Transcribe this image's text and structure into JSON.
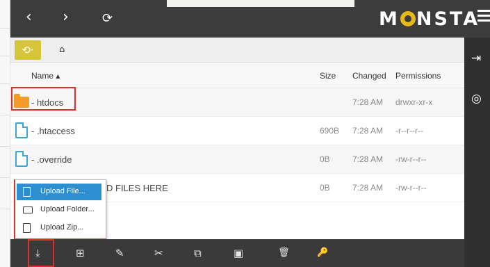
{
  "topbar": {
    "back_icon": "‹",
    "forward_icon": "›",
    "refresh_icon": "⟳",
    "logo_left": "M",
    "logo_right": "NSTA",
    "brand_color": "#e8b81d"
  },
  "breadcrumb": {
    "history_label": "⟲·",
    "home_icon": "⌂"
  },
  "table": {
    "headers": {
      "name": "Name ▴",
      "size": "Size",
      "changed": "Changed",
      "permissions": "Permissions"
    },
    "rows": [
      {
        "name": "- htdocs",
        "size": "",
        "changed": "7:28 AM",
        "permissions": "drwxr-xr-x",
        "type": "folder"
      },
      {
        "name": "- .htaccess",
        "size": "690B",
        "changed": "7:28 AM",
        "permissions": "-r--r--r--",
        "type": "file"
      },
      {
        "name": "- .override",
        "size": "0B",
        "changed": "7:28 AM",
        "permissions": "-rw-r--r--",
        "type": "file"
      },
      {
        "name": "D FILES HERE",
        "size": "0B",
        "changed": "7:28 AM",
        "permissions": "-rw-r--r--",
        "type": "file"
      }
    ]
  },
  "upload_menu": {
    "items": [
      {
        "label": "Upload File...",
        "icon": "file-icon"
      },
      {
        "label": "Upload Folder...",
        "icon": "folder-icon"
      },
      {
        "label": "Upload Zip...",
        "icon": "zip-icon"
      }
    ],
    "active_color": "#2d8fd0"
  },
  "toolbar": {
    "upload": "⤓",
    "new": "⊞",
    "edit": "✎",
    "cut": "✂",
    "copy": "⧉",
    "paste": "▣",
    "delete": "🗑",
    "permissions": "🔑"
  },
  "highlight_color": "#d8332a"
}
